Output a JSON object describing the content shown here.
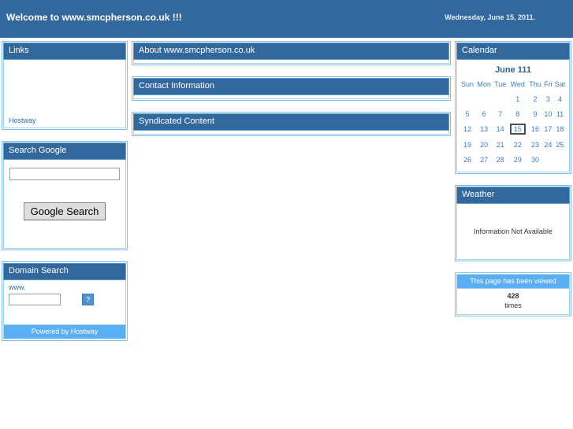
{
  "banner": {
    "title": "Welcome to www.smcpherson.co.uk !!!",
    "date": "Wednesday, June 15, 2011."
  },
  "left": {
    "links_panel": {
      "title": "Links",
      "items": [
        {
          "label": "Hostway"
        }
      ]
    },
    "google_panel": {
      "title": "Search Google",
      "input_value": "",
      "input_placeholder": "",
      "button_label": "Google Search"
    },
    "domain_panel": {
      "title": "Domain Search",
      "prefix_label": "www.",
      "input_value": "",
      "input_placeholder": "",
      "broken_image_glyph": "?",
      "footer_label": "Powered by Hostway"
    }
  },
  "center": {
    "panels": [
      {
        "title": "About www.smcpherson.co.uk"
      },
      {
        "title": "Contact Information"
      },
      {
        "title": "Syndicated Content"
      }
    ]
  },
  "right": {
    "calendar": {
      "title": "Calendar",
      "month_label": "June 111",
      "day_headers": [
        "Sun",
        "Mon",
        "Tue",
        "Wed",
        "Thu",
        "Fri",
        "Sat"
      ],
      "weeks": [
        [
          "",
          "",
          "",
          "1",
          "2",
          "3",
          "4"
        ],
        [
          "5",
          "6",
          "7",
          "8",
          "9",
          "10",
          "11"
        ],
        [
          "12",
          "13",
          "14",
          "15",
          "16",
          "17",
          "18"
        ],
        [
          "19",
          "20",
          "21",
          "22",
          "23",
          "24",
          "25"
        ],
        [
          "26",
          "27",
          "28",
          "29",
          "30",
          "",
          ""
        ]
      ],
      "today": "15"
    },
    "weather": {
      "title": "Weather",
      "message": "Information Not Available"
    },
    "counter": {
      "title": "This page has been viewed",
      "count": "428",
      "unit": "times"
    }
  },
  "colors": {
    "header_blue": "#33689c",
    "panel_border": "#7fc0e8",
    "light_blue": "#5aaff2",
    "link_blue": "#2f6ba5"
  }
}
